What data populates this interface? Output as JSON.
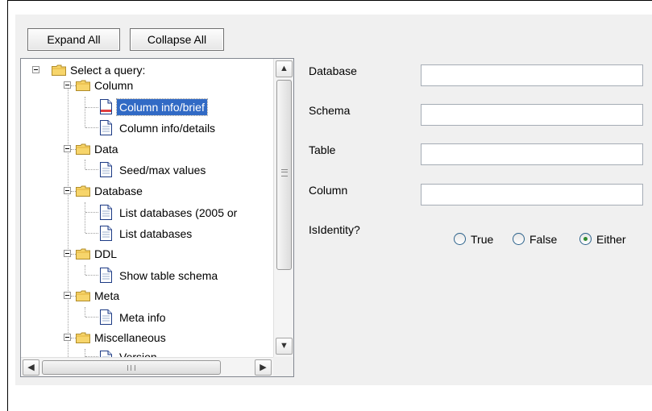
{
  "toolbar": {
    "expand_label": "Expand All",
    "collapse_label": "Collapse All"
  },
  "tree": {
    "root": "Select a query:",
    "nodes": [
      {
        "label": "Column"
      },
      {
        "label": "Column info/brief"
      },
      {
        "label": "Column info/details"
      },
      {
        "label": "Data"
      },
      {
        "label": "Seed/max values"
      },
      {
        "label": "Database"
      },
      {
        "label": "List databases (2005 or"
      },
      {
        "label": "List databases"
      },
      {
        "label": "DDL"
      },
      {
        "label": "Show table schema"
      },
      {
        "label": "Meta"
      },
      {
        "label": "Meta info"
      },
      {
        "label": "Miscellaneous"
      },
      {
        "label": "Version"
      }
    ],
    "selected": "Column info/brief"
  },
  "form": {
    "database_label": "Database",
    "schema_label": "Schema",
    "table_label": "Table",
    "column_label": "Column",
    "isidentity_label": "IsIdentity?",
    "database_value": "",
    "schema_value": "",
    "table_value": "",
    "column_value": "",
    "radios": [
      {
        "label": "True",
        "checked": false
      },
      {
        "label": "False",
        "checked": false
      },
      {
        "label": "Either",
        "checked": true
      }
    ]
  },
  "icons": {
    "folder": "folder-icon",
    "document": "document-icon"
  },
  "colors": {
    "selection": "#316ac5",
    "panel": "#f0f0f0",
    "radio_dot": "#2f8a2f"
  }
}
